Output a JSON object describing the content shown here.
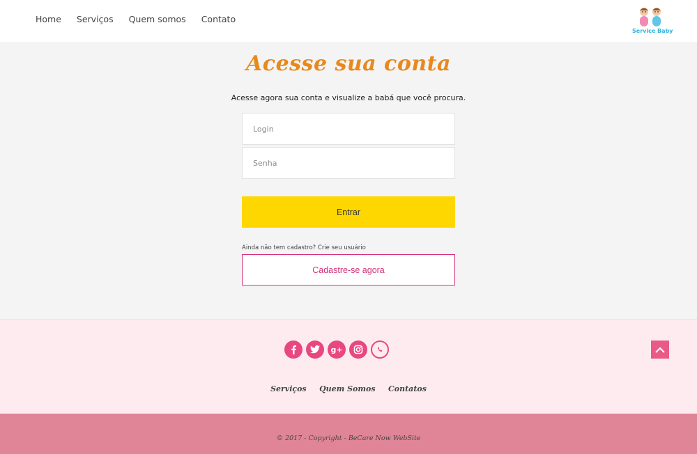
{
  "header": {
    "nav": [
      "Home",
      "Serviços",
      "Quem somos",
      "Contato"
    ],
    "logo_text": "Service Baby"
  },
  "main": {
    "title": "Acesse sua conta",
    "subtitle": "Acesse agora sua conta e visualize a babá que você procura.",
    "login_placeholder": "Login",
    "senha_placeholder": "Senha",
    "entrar_label": "Entrar",
    "hint": "Ainda não tem cadastro? Crie seu usuário",
    "cadastre_label": "Cadastre-se agora"
  },
  "footer": {
    "social_icons": [
      "facebook-icon",
      "twitter-icon",
      "google-plus-icon",
      "instagram-icon",
      "whatsapp-icon"
    ],
    "links": [
      "Serviços",
      "Quem Somos",
      "Contatos"
    ],
    "copyright": "© 2017 - Copyright - BeCare Now WebSite"
  },
  "colors": {
    "accent_orange": "#e8891c",
    "button_yellow": "#ffd700",
    "brand_pink": "#d4317a",
    "footer_bg": "#fdebef",
    "bottom_bar": "#e08597"
  }
}
